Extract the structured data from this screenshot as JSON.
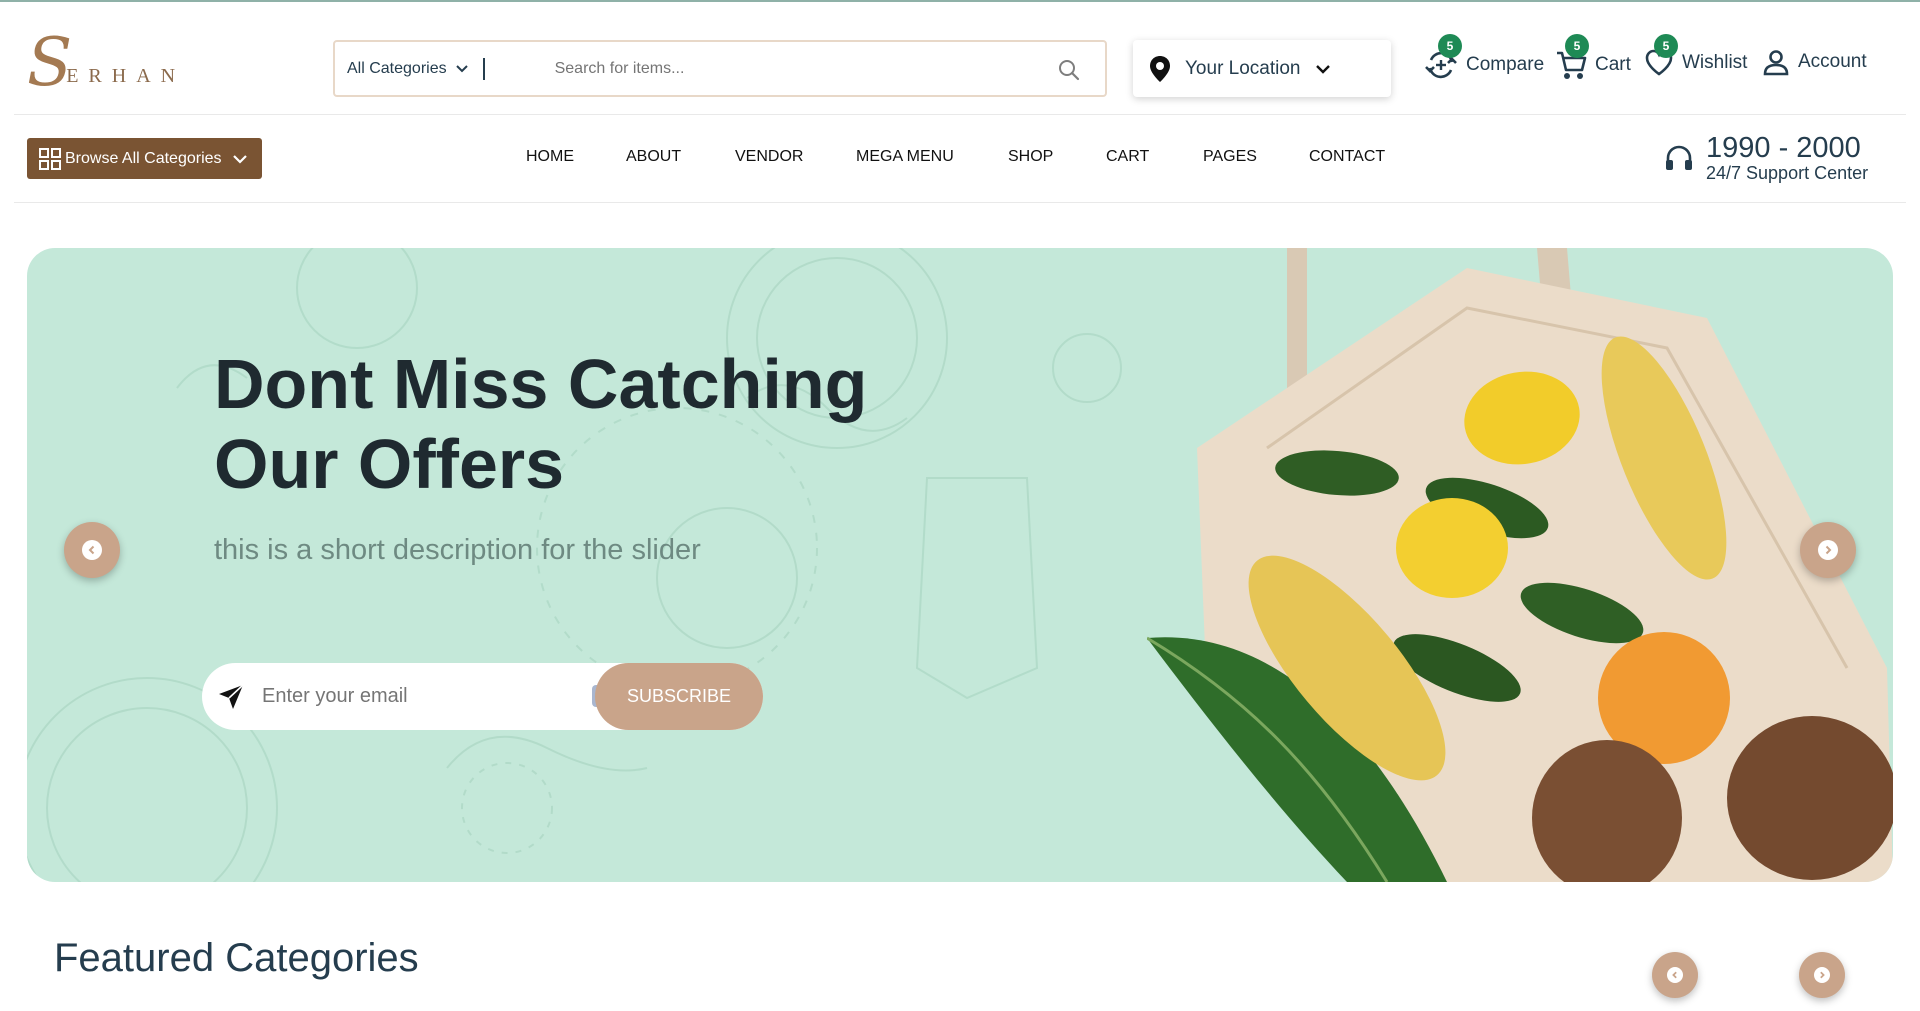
{
  "brand": {
    "logo_initial": "S",
    "logo_rest": "ERHAN"
  },
  "search": {
    "category_label": "All Categories",
    "placeholder": "Search for items..."
  },
  "location": {
    "label": "Your Location"
  },
  "header_actions": [
    {
      "label": "Compare",
      "count": "5"
    },
    {
      "label": "Cart",
      "count": "5"
    },
    {
      "label": "Wishlist",
      "count": "5"
    },
    {
      "label": "Account"
    }
  ],
  "browse": {
    "label": "Browse All Categories"
  },
  "nav": [
    "HOME",
    "ABOUT",
    "VENDOR",
    "MEGA MENU",
    "SHOP",
    "CART",
    "PAGES",
    "CONTACT"
  ],
  "support": {
    "number": "1990 - 2000",
    "label": "24/7 Support Center"
  },
  "hero": {
    "title_line1": "Dont Miss Catching",
    "title_line2": "Our Offers",
    "description": "this is a short description for the slider",
    "email_placeholder": "Enter your email",
    "subscribe_label": "SUBSCRIBE"
  },
  "featured": {
    "title": "Featured Categories"
  },
  "colors": {
    "brand_brown": "#7a5433",
    "accent_tan": "#c9a48a",
    "hero_bg": "#c4e8d9",
    "badge_green": "#1e8a55"
  }
}
